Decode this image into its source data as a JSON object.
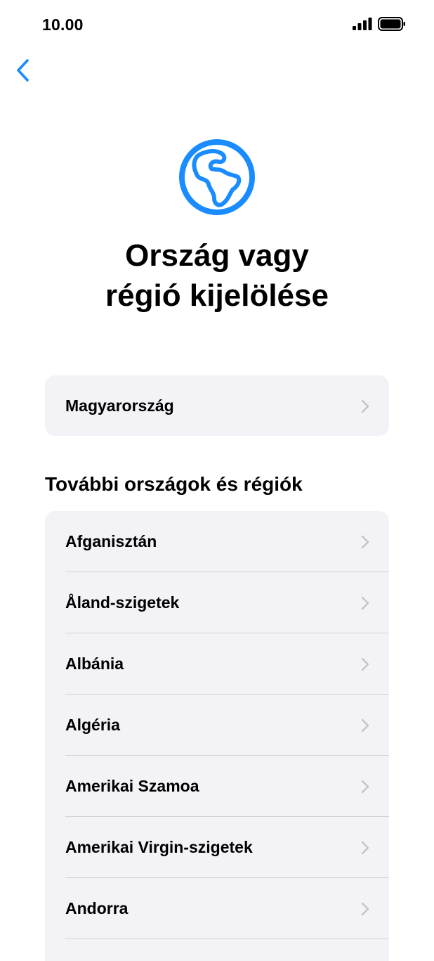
{
  "status_bar": {
    "time": "10.00",
    "icons": [
      "signal-icon",
      "battery-icon"
    ]
  },
  "navigation": {
    "back_icon": "chevron-left-icon"
  },
  "header": {
    "icon": "globe-icon",
    "title_line1": "Ország vagy",
    "title_line2": "régió kijelölése"
  },
  "current": {
    "label": "Magyarország"
  },
  "more_section": {
    "title": "További országok és régiók",
    "items": [
      {
        "label": "Afganisztán"
      },
      {
        "label": "Åland-szigetek"
      },
      {
        "label": "Albánia"
      },
      {
        "label": "Algéria"
      },
      {
        "label": "Amerikai Szamoa"
      },
      {
        "label": "Amerikai Virgin-szigetek"
      },
      {
        "label": "Andorra"
      }
    ]
  },
  "colors": {
    "accent": "#1a8cff",
    "card_background": "#f2f2f7",
    "chevron": "#c4c4c8",
    "divider": "#d1d1d6"
  }
}
